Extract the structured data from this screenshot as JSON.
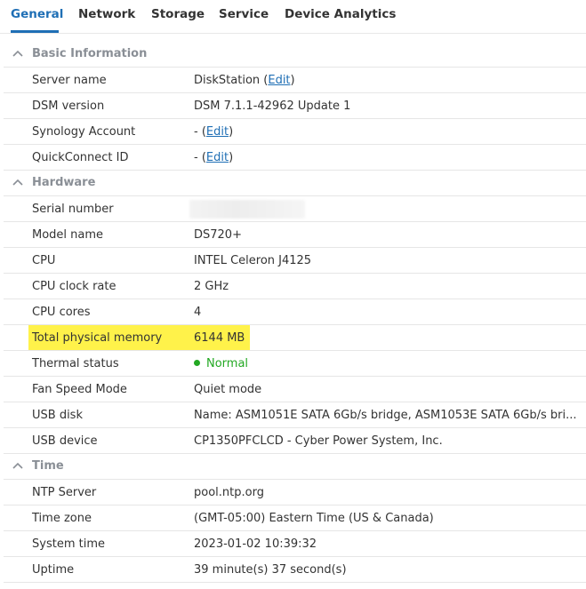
{
  "tabs": [
    {
      "label": "General"
    },
    {
      "label": "Network"
    },
    {
      "label": "Storage"
    },
    {
      "label": "Service"
    },
    {
      "label": "Device Analytics"
    }
  ],
  "sections": {
    "basic": {
      "title": "Basic Information"
    },
    "hardware": {
      "title": "Hardware"
    },
    "time": {
      "title": "Time"
    }
  },
  "basic": {
    "server_name": {
      "label": "Server name",
      "value": "DiskStation",
      "edit": "Edit"
    },
    "dsm_version": {
      "label": "DSM version",
      "value": "DSM 7.1.1-42962 Update 1"
    },
    "synology_account": {
      "label": "Synology Account",
      "value": "-",
      "edit": "Edit"
    },
    "quickconnect_id": {
      "label": "QuickConnect ID",
      "value": "-",
      "edit": "Edit"
    }
  },
  "hardware": {
    "serial_number": {
      "label": "Serial number"
    },
    "model_name": {
      "label": "Model name",
      "value": "DS720+"
    },
    "cpu": {
      "label": "CPU",
      "value": "INTEL Celeron J4125"
    },
    "cpu_clock": {
      "label": "CPU clock rate",
      "value": "2 GHz"
    },
    "cpu_cores": {
      "label": "CPU cores",
      "value": "4"
    },
    "memory": {
      "label": "Total physical memory",
      "value": "6144 MB",
      "highlight_color": "#fff24a"
    },
    "thermal": {
      "label": "Thermal status",
      "value": "Normal",
      "status_color": "#22a822"
    },
    "fan": {
      "label": "Fan Speed Mode",
      "value": "Quiet mode"
    },
    "usb_disk": {
      "label": "USB disk",
      "value": "Name: ASM1051E SATA 6Gb/s bridge, ASM1053E SATA 6Gb/s bri..."
    },
    "usb_device": {
      "label": "USB device",
      "value": "CP1350PFCLCD - Cyber Power System, Inc."
    }
  },
  "time": {
    "ntp": {
      "label": "NTP Server",
      "value": "pool.ntp.org"
    },
    "timezone": {
      "label": "Time zone",
      "value": "(GMT-05:00) Eastern Time (US & Canada)"
    },
    "system_time": {
      "label": "System time",
      "value": "2023-01-02 10:39:32"
    },
    "uptime": {
      "label": "Uptime",
      "value": "39 minute(s) 37 second(s)"
    }
  },
  "colors": {
    "accent": "#1f6fb5",
    "section_title": "#8a8f96"
  }
}
